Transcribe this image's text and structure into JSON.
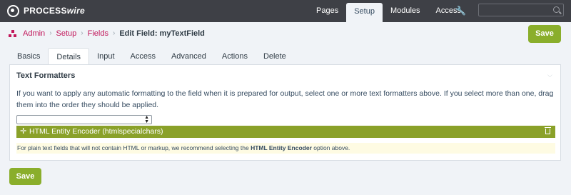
{
  "brand": {
    "logo_icon": "processwire-logo-icon",
    "name_part1": "PROCESS",
    "name_part2": "wire"
  },
  "top_nav": [
    {
      "label": "Pages"
    },
    {
      "label": "Setup",
      "active": true
    },
    {
      "label": "Modules"
    },
    {
      "label": "Access"
    }
  ],
  "tools_icon": "wrench-icon",
  "search": {
    "value": "",
    "placeholder": "",
    "icon": "search-icon"
  },
  "breadcrumb": {
    "home_icon": "sitemap-icon",
    "items": [
      "Admin",
      "Setup",
      "Fields"
    ],
    "current": "Edit Field: myTextField"
  },
  "actions": {
    "save_label": "Save"
  },
  "tabs": [
    {
      "label": "Basics"
    },
    {
      "label": "Details",
      "active": true
    },
    {
      "label": "Input"
    },
    {
      "label": "Access"
    },
    {
      "label": "Advanced"
    },
    {
      "label": "Actions"
    },
    {
      "label": "Delete"
    }
  ],
  "text_formatters": {
    "label": "Text Formatters",
    "description": "If you want to apply any automatic formatting to the field when it is prepared for output, select one or more text formatters above. If you select more than one, drag them into the order they should be applied.",
    "select_value": "",
    "selected": [
      {
        "label": "HTML Entity Encoder (htmlspecialchars)"
      }
    ],
    "notes_before": "For plain text fields that will not contain HTML or markup, we recommend selecting the ",
    "notes_bold": "HTML Entity Encoder",
    "notes_after": " option above."
  },
  "colors": {
    "topbar": "#3e4046",
    "accent_green": "#8aae2b",
    "link_pink": "#c2185b",
    "notes_bg": "#fefbe3"
  }
}
